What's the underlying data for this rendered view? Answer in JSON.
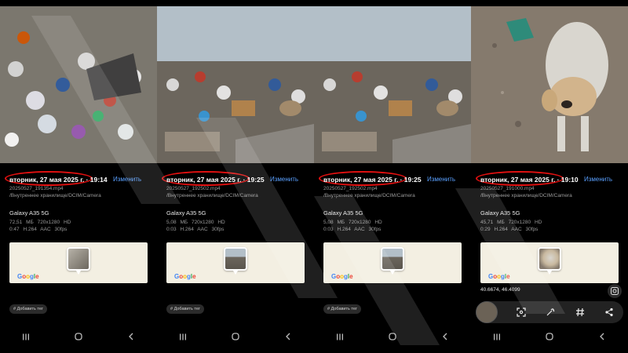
{
  "panels": [
    {
      "datetime": "вторник, 27 мая 2025 г. · 19:14",
      "edit_label": "Изменить",
      "filename": "20250527_191354.mp4",
      "path": "/Внутреннее хранилище/DCIM/Camera",
      "device": "Galaxy A35 5G",
      "size": "72,51 МБ",
      "resolution": "720x1280",
      "quality": "HD",
      "duration": "0:47",
      "codec": "H.264",
      "audio": "AAC",
      "fps": "30fps",
      "map_brand": "Google",
      "tag_label": "# Добавить тег"
    },
    {
      "datetime": "вторник, 27 мая 2025 г. · 19:25",
      "edit_label": "Изменить",
      "filename": "20250527_192502.mp4",
      "path": "/Внутреннее хранилище/DCIM/Camera",
      "device": "Galaxy A35 5G",
      "size": "5,08 МБ",
      "resolution": "720x1280",
      "quality": "HD",
      "duration": "0:03",
      "codec": "H.264",
      "audio": "AAC",
      "fps": "30fps",
      "map_brand": "Google",
      "tag_label": "# Добавить тег"
    },
    {
      "datetime": "вторник, 27 мая 2025 г. · 19:25",
      "edit_label": "Изменить",
      "filename": "20250527_192502.mp4",
      "path": "/Внутреннее хранилище/DCIM/Camera",
      "device": "Galaxy A35 5G",
      "size": "5,08 МБ",
      "resolution": "720x1280",
      "quality": "HD",
      "duration": "0:03",
      "codec": "H.264",
      "audio": "AAC",
      "fps": "30fps",
      "map_brand": "Google",
      "tag_label": "# Добавить тег"
    },
    {
      "datetime": "вторник, 27 мая 2025 г. · 19:10",
      "edit_label": "Изменить",
      "filename": "20250527_191000.mp4",
      "path": "/Внутреннее хранилище/DCIM/Camera",
      "device": "Galaxy A35 5G",
      "size": "45,71 МБ",
      "resolution": "720x1280",
      "quality": "HD",
      "duration": "0:29",
      "codec": "H.264",
      "audio": "AAC",
      "fps": "30fps",
      "map_brand": "Google",
      "coordinates": "40.6674, 46.4099"
    }
  ],
  "colors": {
    "highlight_oval": "#e01010",
    "edit_link": "#5aa0ff",
    "background": "#000000"
  },
  "icons": {
    "nav_recents": "recents-icon",
    "nav_home": "home-icon",
    "nav_back": "back-icon",
    "toolbar": [
      "scan-icon",
      "remaster-icon",
      "hashtag-icon",
      "share-icon"
    ]
  }
}
